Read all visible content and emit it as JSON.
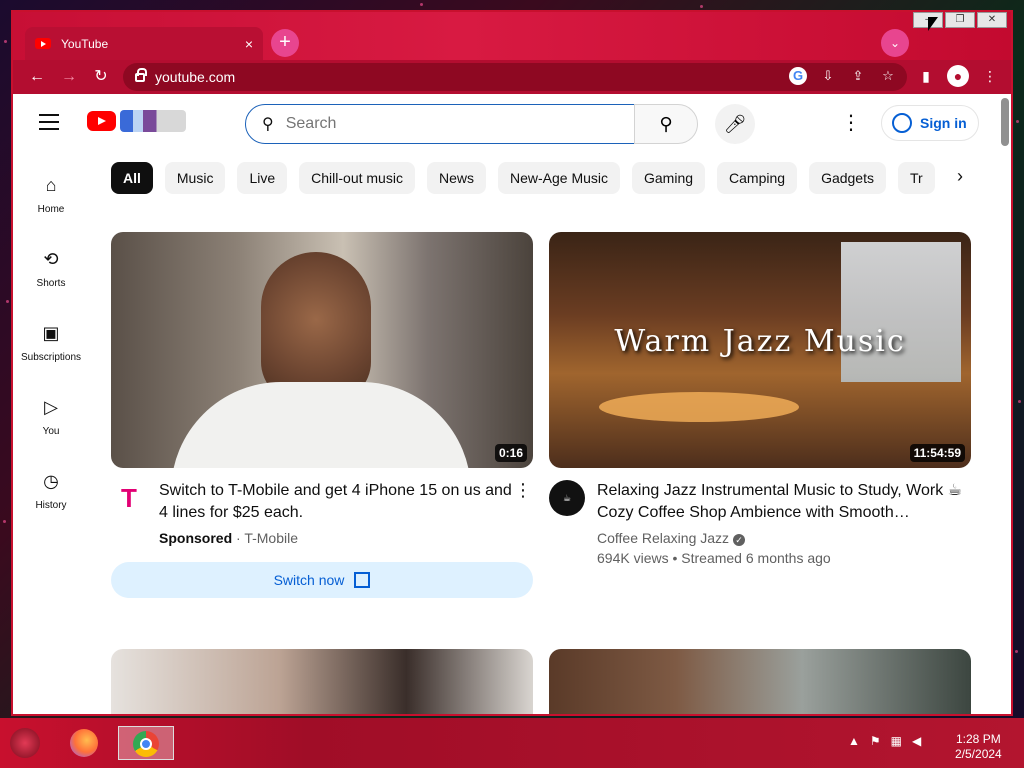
{
  "browser": {
    "tab_title": "YouTube",
    "tab_close": "×",
    "new_tab": "+",
    "tab_search": "⌄",
    "url": "youtube.com",
    "win_minimize": "–",
    "win_restore": "❐",
    "win_close": "✕",
    "nav_back": "←",
    "nav_forward": "→",
    "nav_reload": "↻"
  },
  "youtube": {
    "search_placeholder": "Search",
    "signin_label": "Sign in",
    "sidebar": [
      {
        "label": "Home",
        "icon": "⌂"
      },
      {
        "label": "Shorts",
        "icon": "⟲"
      },
      {
        "label": "Subscriptions",
        "icon": "▣"
      },
      {
        "label": "You",
        "icon": "▷"
      },
      {
        "label": "History",
        "icon": "◷"
      }
    ],
    "chips": [
      "All",
      "Music",
      "Live",
      "Chill-out music",
      "News",
      "New-Age Music",
      "Gaming",
      "Camping",
      "Gadgets",
      "Tr"
    ],
    "videos": [
      {
        "title": "Switch to T-Mobile and get 4 iPhone 15 on us and 4 lines for $25 each.",
        "sponsored": "Sponsored",
        "channel": "T-Mobile",
        "duration": "0:16",
        "cta": "Switch now",
        "avatar_glyph": "T"
      },
      {
        "title": "Relaxing Jazz Instrumental Music to Study, Work ☕ Cozy Coffee Shop Ambience with Smooth…",
        "overlay": "Warm Jazz Music",
        "channel": "Coffee Relaxing Jazz",
        "stats": "694K views • Streamed 6 months ago",
        "duration": "11:54:59",
        "avatar_glyph": "☕"
      }
    ]
  },
  "taskbar": {
    "time": "1:28 PM",
    "date": "2/5/2024"
  },
  "colors": {
    "browser_accent": "#c8102e",
    "yt_red": "#ff0000",
    "link_blue": "#065fd4"
  }
}
